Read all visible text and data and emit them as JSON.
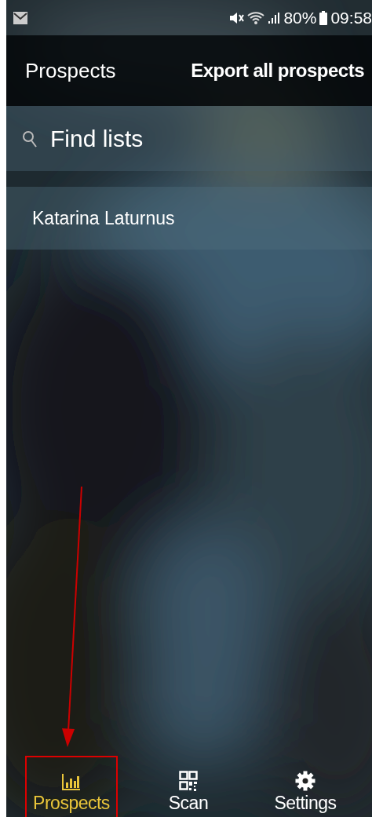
{
  "status_bar": {
    "battery": "80%",
    "time": "09:58"
  },
  "app_bar": {
    "title": "Prospects",
    "action": "Export all prospects"
  },
  "search": {
    "placeholder": "Find lists"
  },
  "lists": [
    {
      "name": "Katarina Laturnus"
    }
  ],
  "bottom_nav": [
    {
      "kind": "chart",
      "label": "Prospects",
      "selected": true,
      "highlighted": true
    },
    {
      "kind": "qr",
      "label": "Scan",
      "selected": false,
      "highlighted": false
    },
    {
      "kind": "gear",
      "label": "Settings",
      "selected": false,
      "highlighted": false
    }
  ]
}
